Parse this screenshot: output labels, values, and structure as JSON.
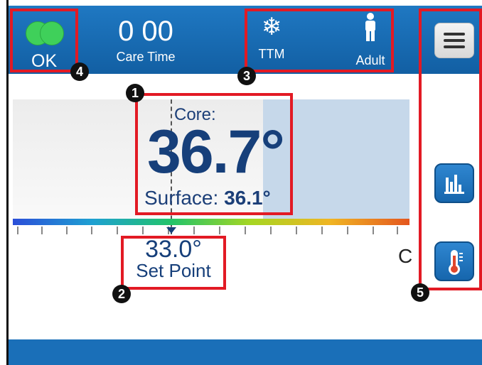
{
  "status": {
    "label": "OK"
  },
  "care_time": {
    "value": "0 00",
    "label": "Care Time"
  },
  "modes": {
    "ttm_label": "TTM",
    "patient_label": "Adult"
  },
  "temperature": {
    "core_label": "Core:",
    "core_value": "36.7°",
    "surface_label": "Surface: ",
    "surface_value": "36.1°"
  },
  "setpoint": {
    "value": "33.0°",
    "label": "Set Point"
  },
  "unit": "C",
  "callouts": [
    "1",
    "2",
    "3",
    "4",
    "5"
  ],
  "colors": {
    "header": "#1a6fb8",
    "accent": "#163f7a",
    "callout": "#e21a24",
    "status": "#3fd05a"
  },
  "icons": [
    "snowflake-icon",
    "adult-person-icon",
    "menu-icon",
    "bar-chart-icon",
    "thermometer-icon"
  ]
}
